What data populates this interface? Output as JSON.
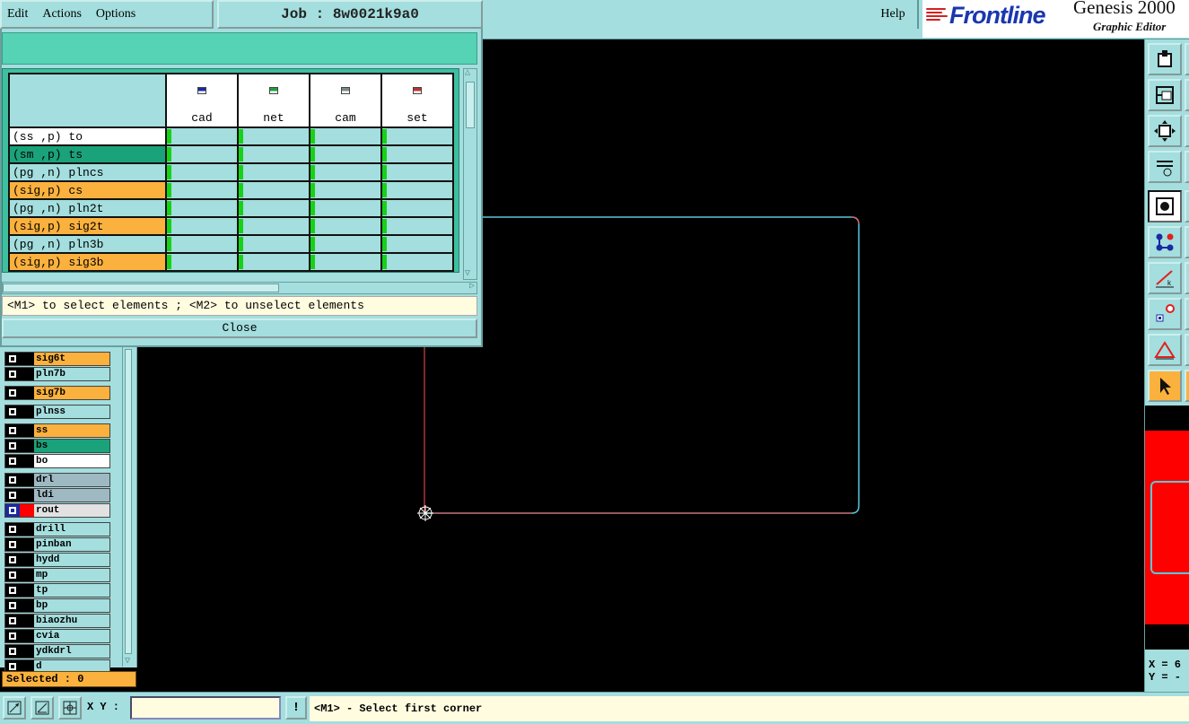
{
  "menu": {
    "items": [
      "Edit",
      "Actions",
      "Options"
    ]
  },
  "job": {
    "label": "Job",
    "separator": ":",
    "name": "8w0021k9a0"
  },
  "help_label": "Help",
  "brand": {
    "logo": "Frontline",
    "product": "Genesis 2000",
    "subtitle": "Graphic Editor"
  },
  "colors": {
    "teal_bg": "#a4dede",
    "header_green": "#56d2b4",
    "layer_yellow": "#fbb13d",
    "layer_green": "#1aa27a",
    "layer_white": "#ffffff",
    "layer_grey": "#9fb9c3",
    "rout_red": "#ff0000",
    "board_outline": "#5ac8d8",
    "board_red_edge": "#ff5050"
  },
  "matrix": {
    "columns": [
      {
        "name": "cad",
        "icon": "cad-step-icon"
      },
      {
        "name": "net",
        "icon": "net-step-icon"
      },
      {
        "name": "cam",
        "icon": "cam-step-icon"
      },
      {
        "name": "set",
        "icon": "set-step-icon"
      }
    ],
    "rows": [
      {
        "label": "(ss ,p) to",
        "color": "#ffffff"
      },
      {
        "label": "(sm ,p) ts",
        "color": "#1aa27a"
      },
      {
        "label": "(pg ,n) plncs",
        "color": "#a4dede"
      },
      {
        "label": "(sig,p) cs",
        "color": "#fbb13d"
      },
      {
        "label": "(pg ,n) pln2t",
        "color": "#a4dede"
      },
      {
        "label": "(sig,p) sig2t",
        "color": "#fbb13d"
      },
      {
        "label": "(pg ,n) pln3b",
        "color": "#a4dede"
      },
      {
        "label": "(sig,p) sig3b",
        "color": "#fbb13d"
      }
    ]
  },
  "dialog": {
    "instruction": "<M1> to select elements ; <M2> to unselect elements",
    "close_label": "Close"
  },
  "layers": [
    {
      "name": "sig6t",
      "color": "#fbb13d",
      "group_start": false
    },
    {
      "name": "pln7b",
      "color": "#a4dede",
      "group_start": false
    },
    {
      "name": "sig7b",
      "color": "#fbb13d",
      "group_start": true
    },
    {
      "name": "plnss",
      "color": "#a4dede",
      "group_start": true
    },
    {
      "name": "ss",
      "color": "#fbb13d",
      "group_start": true
    },
    {
      "name": "bs",
      "color": "#1aa27a",
      "group_start": false
    },
    {
      "name": "bo",
      "color": "#ffffff",
      "group_start": false
    },
    {
      "name": "drl",
      "color": "#9fb9c3",
      "group_start": true
    },
    {
      "name": "ldi",
      "color": "#9fb9c3",
      "group_start": false
    },
    {
      "name": "rout",
      "color": "#e2e2e2",
      "group_start": false,
      "active": true
    },
    {
      "name": "drill",
      "color": "#a4dede",
      "group_start": true
    },
    {
      "name": "pinban",
      "color": "#a4dede",
      "group_start": false
    },
    {
      "name": "hydd",
      "color": "#a4dede",
      "group_start": false
    },
    {
      "name": "mp",
      "color": "#a4dede",
      "group_start": false
    },
    {
      "name": "tp",
      "color": "#a4dede",
      "group_start": false
    },
    {
      "name": "bp",
      "color": "#a4dede",
      "group_start": false
    },
    {
      "name": "biaozhu",
      "color": "#a4dede",
      "group_start": false
    },
    {
      "name": "cvia",
      "color": "#a4dede",
      "group_start": false
    },
    {
      "name": "ydkdrl",
      "color": "#a4dede",
      "group_start": false
    },
    {
      "name": "d",
      "color": "#a4dede",
      "group_start": false
    }
  ],
  "selected_text": "Selected : 0",
  "status": {
    "xy_label": "X Y :",
    "xy_value": "",
    "hint": "<M1> - Select first corner"
  },
  "coords": {
    "x": "X = 6",
    "y": "Y = -"
  },
  "right_tools": [
    "step-icon",
    "zoom-previous-icon",
    "fit-icon",
    "snap-config-icon",
    "record-icon",
    "nets-icon",
    "line-tool-icon",
    "feature-select-icon",
    "measure-icon",
    "pointer-icon"
  ]
}
